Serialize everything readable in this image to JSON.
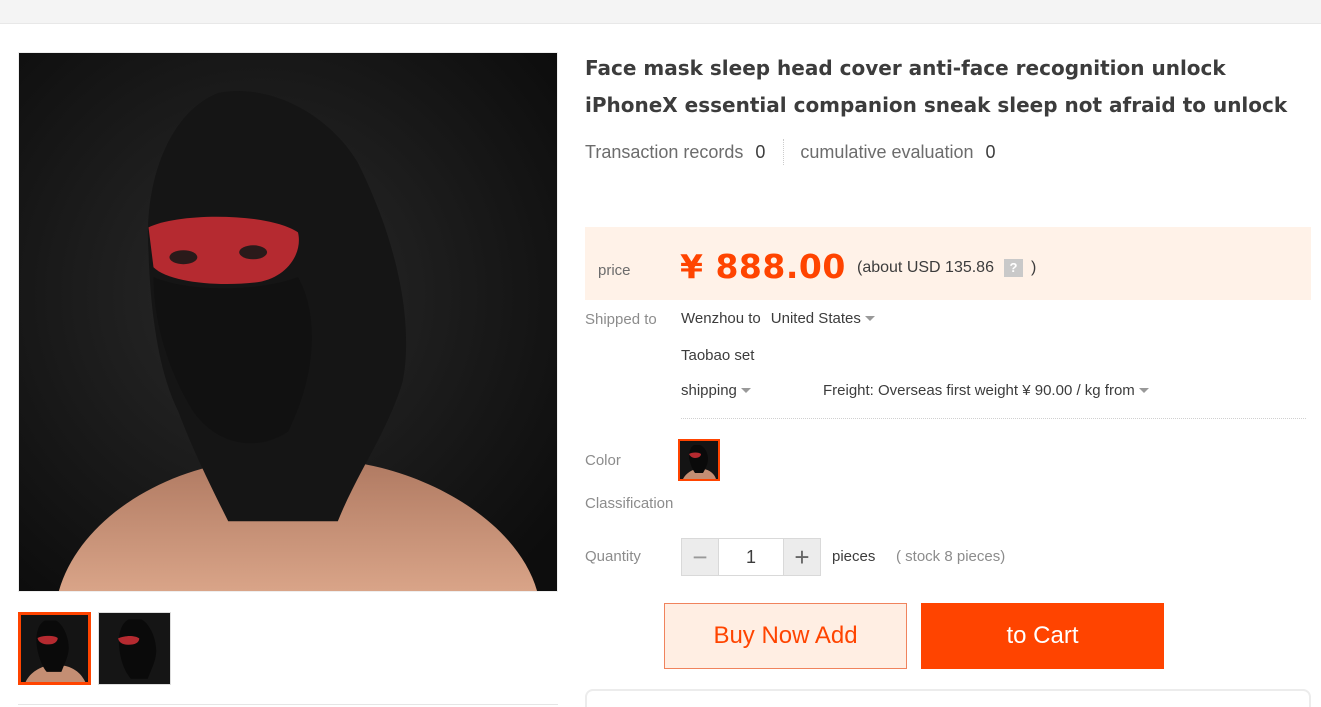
{
  "product": {
    "title": "Face mask sleep head cover anti-face recognition unlock iPhoneX essential companion sneak sleep not afraid to unlock",
    "stats": {
      "transaction_label": "Transaction records",
      "transaction_count": "0",
      "evaluation_label": "cumulative evaluation",
      "evaluation_count": "0"
    },
    "price": {
      "label": "price",
      "value": "¥ 888.00",
      "usd_prefix": "(about USD 135.86",
      "usd_suffix": ")",
      "help_icon": "?"
    },
    "shipping": {
      "label": "Shipped to",
      "from": "Wenzhou to",
      "destination": "United States",
      "taobao_set": "Taobao set",
      "method": "shipping",
      "freight": "Freight: Overseas first weight ¥ 90.00 / kg from"
    },
    "color_label": "Color",
    "classification_label": "Classification",
    "quantity": {
      "label": "Quantity",
      "value": "1",
      "unit": "pieces",
      "stock": "( stock 8 pieces)"
    },
    "buttons": {
      "buy_now": "Buy Now Add",
      "add_cart": "to Cart"
    }
  },
  "icons": {
    "help": "question-icon",
    "caret": "caret-down-icon",
    "minus": "minus-icon",
    "plus": "plus-icon"
  },
  "colors": {
    "accent": "#ff4400",
    "price_bg": "#fff2e8"
  }
}
